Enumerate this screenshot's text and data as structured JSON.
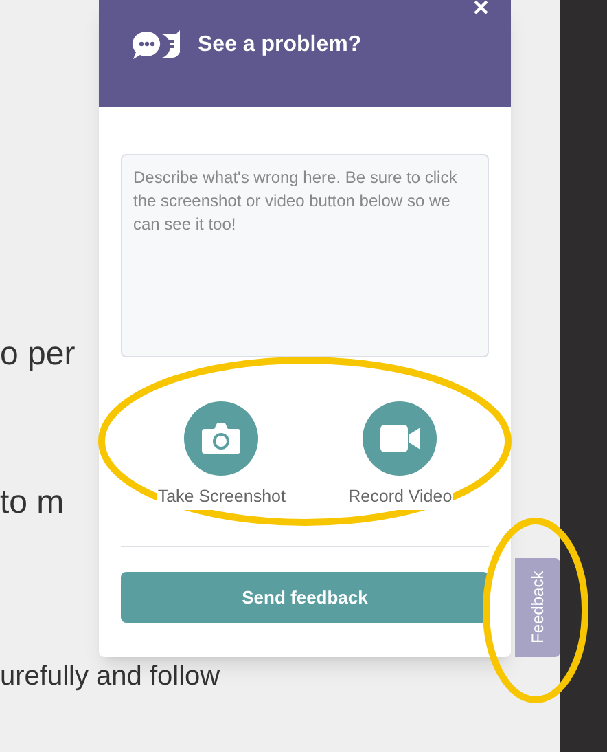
{
  "page_text": [
    "o per",
    "to m",
    "urefully and follow"
  ],
  "dialog": {
    "title": "See a problem?",
    "close": "×",
    "description": {
      "placeholder": "Describe what's wrong here. Be sure to click the screenshot or video button below so we can see it too!"
    },
    "capture_buttons": [
      {
        "kind": "camera",
        "label": "Take Screenshot"
      },
      {
        "kind": "video",
        "label": "Record Video"
      }
    ],
    "submit": "Send feedback"
  },
  "feedback_tab": "Feedback"
}
